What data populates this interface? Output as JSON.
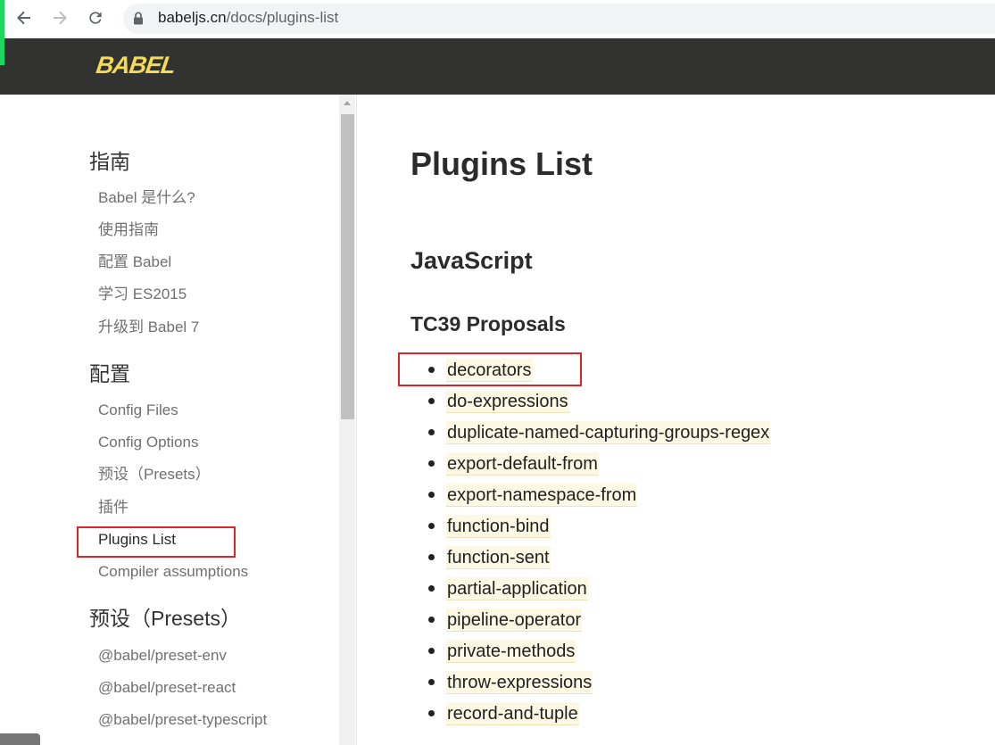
{
  "browser": {
    "url": {
      "domain": "babeljs.cn",
      "path": "/docs/plugins-list"
    },
    "icons": {
      "back": "back-arrow-icon",
      "forward": "forward-arrow-icon",
      "reload": "reload-icon",
      "secure": "lock-icon"
    }
  },
  "header": {
    "logo_text": "BABEL"
  },
  "sidebar": {
    "active_item": "Plugins List",
    "sections": [
      {
        "title": "指南",
        "items": [
          "Babel 是什么?",
          "使用指南",
          "配置 Babel",
          "学习 ES2015",
          "升级到 Babel 7"
        ]
      },
      {
        "title": "配置",
        "items": [
          "Config Files",
          "Config Options",
          "预设（Presets）",
          "插件",
          "Plugins List",
          "Compiler assumptions"
        ]
      },
      {
        "title": "预设（Presets）",
        "items": [
          "@babel/preset-env",
          "@babel/preset-react",
          "@babel/preset-typescript"
        ]
      }
    ]
  },
  "content": {
    "title": "Plugins List",
    "section_title": "JavaScript",
    "subsection_title": "TC39 Proposals",
    "plugins": [
      "decorators",
      "do-expressions",
      "duplicate-named-capturing-groups-regex",
      "export-default-from",
      "export-namespace-from",
      "function-bind",
      "function-sent",
      "partial-application",
      "pipeline-operator",
      "private-methods",
      "throw-expressions",
      "record-and-tuple"
    ]
  },
  "colors": {
    "header_background": "#323330",
    "logo": "#f5da55",
    "link_highlight": "#fdf8e4",
    "link_border": "#efe3bc",
    "annotation": "#d9262b",
    "tab_stripe": "#1ed760"
  }
}
